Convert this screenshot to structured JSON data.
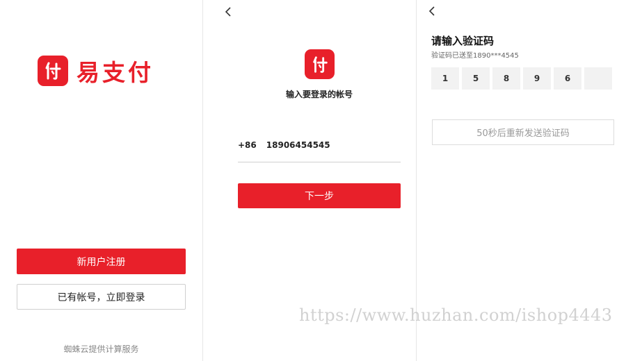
{
  "welcome": {
    "brand_name": "易支付",
    "register_label": "新用户注册",
    "login_label": "已有帐号，立即登录",
    "footer_text": "蜘蛛云提供计算服务"
  },
  "login": {
    "back_glyph": "<",
    "title": "输入要登录的帐号",
    "country_code": "+86",
    "phone_value": "18906454545",
    "next_label": "下一步"
  },
  "verify": {
    "back_glyph": "<",
    "title": "请输入验证码",
    "subtitle": "验证码已送至1890***4545",
    "digits": [
      "1",
      "5",
      "8",
      "9",
      "6",
      ""
    ],
    "resend_label": "50秒后重新发送验证码"
  },
  "watermark": "https://www.huzhan.com/ishop4443",
  "colors": {
    "brand_red": "#e8202a",
    "border_gray": "#cfcfcf",
    "code_bg": "#f2f2f2"
  },
  "icons": {
    "logo": "pay-logo-icon",
    "back": "chevron-left-icon"
  }
}
